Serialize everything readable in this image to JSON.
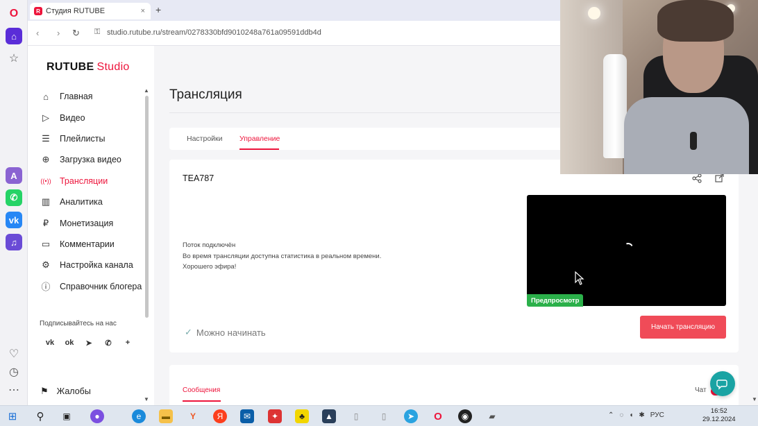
{
  "browser": {
    "tab_title": "Студия RUTUBE",
    "tab_close": "×",
    "new_tab": "+",
    "url": "studio.rutube.ru/stream/0278330bfd9010248a761a09591ddb4d",
    "nav": {
      "back": "‹",
      "forward": "›",
      "reload": "↻",
      "lock": "⚿"
    }
  },
  "logo": {
    "brand": "RUTUBE",
    "product": "Studio",
    "accent": "#ed143b"
  },
  "sidebar": {
    "items": [
      {
        "label": "Главная",
        "icon": "home-icon",
        "glyph": "⌂"
      },
      {
        "label": "Видео",
        "icon": "video-icon",
        "glyph": "▷"
      },
      {
        "label": "Плейлисты",
        "icon": "playlist-icon",
        "glyph": "☰"
      },
      {
        "label": "Загрузка видео",
        "icon": "upload-icon",
        "glyph": "⊕"
      },
      {
        "label": "Трансляции",
        "icon": "broadcast-icon",
        "glyph": "((•))",
        "active": true
      },
      {
        "label": "Аналитика",
        "icon": "analytics-icon",
        "glyph": "▥"
      },
      {
        "label": "Монетизация",
        "icon": "ruble-icon",
        "glyph": "₽"
      },
      {
        "label": "Комментарии",
        "icon": "comment-icon",
        "glyph": "▭"
      },
      {
        "label": "Настройка канала",
        "icon": "gear-icon",
        "glyph": "⚙"
      },
      {
        "label": "Справочник блогера",
        "icon": "help-icon",
        "glyph": "ⓘ"
      }
    ],
    "subscribe_label": "Подписывайтесь на нас",
    "socials": [
      {
        "name": "vk-icon",
        "glyph": "vk"
      },
      {
        "name": "odnoklassniki-icon",
        "glyph": "ok"
      },
      {
        "name": "telegram-icon",
        "glyph": "➤"
      },
      {
        "name": "viber-icon",
        "glyph": "✆"
      },
      {
        "name": "more-icon",
        "glyph": "+"
      }
    ],
    "complaints_label": "Жалобы",
    "complaints_glyph": "⚑"
  },
  "main": {
    "page_title": "Трансляция",
    "tabs": [
      {
        "label": "Настройки"
      },
      {
        "label": "Управление",
        "active": true
      }
    ],
    "stream": {
      "name": "TEA787",
      "status_lines": [
        "Поток подключён",
        "Во время трансляции доступна статистика в реальном времени.",
        "Хорошего эфира!"
      ],
      "preview_badge": "Предпросмотр",
      "ready_label": "Можно начинать",
      "start_button": "Начать трансляцию",
      "share_glyph": "≺",
      "open_glyph": "⧉"
    },
    "messages_tab": "Сообщения",
    "chat_label": "Чат"
  },
  "taskbar": {
    "language": "РУС",
    "time": "16:52",
    "date": "29.12.2024"
  },
  "colors": {
    "accent": "#ed143b",
    "button": "#f04b58",
    "preview_badge": "#2bb04a",
    "help_button": "#1aa3a3"
  }
}
